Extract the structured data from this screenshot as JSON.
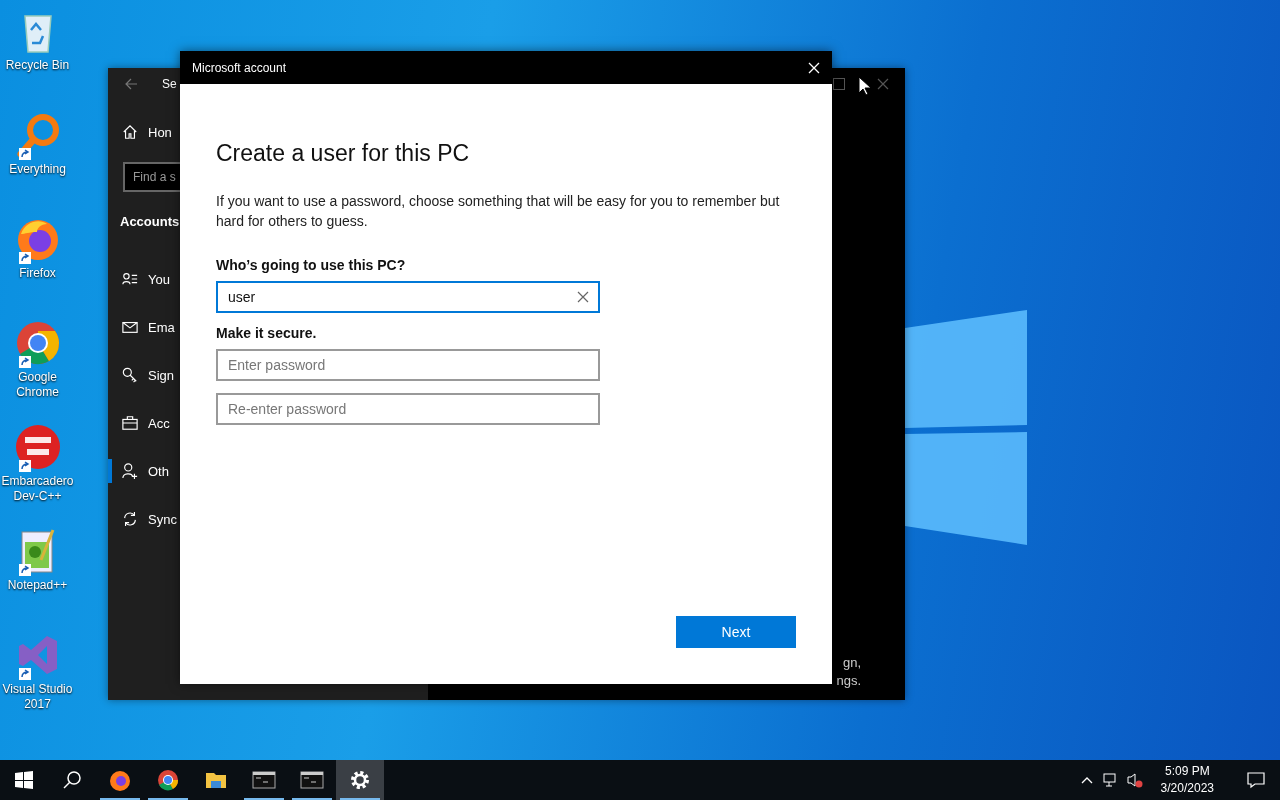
{
  "desktop_icons": [
    {
      "label": "Recycle Bin",
      "kind": "recycle",
      "shortcut": false
    },
    {
      "label": "Everything",
      "kind": "everything",
      "shortcut": true
    },
    {
      "label": "Firefox",
      "kind": "firefox",
      "shortcut": true
    },
    {
      "label": "Google Chrome",
      "kind": "chrome",
      "shortcut": true
    },
    {
      "label": "Embarcadero Dev-C++",
      "kind": "devcpp",
      "shortcut": true
    },
    {
      "label": "Notepad++",
      "kind": "notepadpp",
      "shortcut": true
    },
    {
      "label": "Visual Studio 2017",
      "kind": "vs",
      "shortcut": true
    }
  ],
  "settings_window": {
    "title": "Se",
    "home": {
      "label": "Hon"
    },
    "search": {
      "placeholder": "Find a s"
    },
    "section": "Accounts",
    "items": [
      {
        "label": "You",
        "kind": "info",
        "selected": false
      },
      {
        "label": "Ema",
        "kind": "mail",
        "selected": false
      },
      {
        "label": "Sign",
        "kind": "key",
        "selected": false
      },
      {
        "label": "Acc",
        "kind": "briefcase",
        "selected": false
      },
      {
        "label": "Oth",
        "kind": "person-add",
        "selected": true
      },
      {
        "label": "Sync",
        "kind": "sync",
        "selected": false
      }
    ],
    "footer_lines": [
      "gn,",
      "ngs."
    ]
  },
  "dialog": {
    "title": "Microsoft account",
    "heading": "Create a user for this PC",
    "description": "If you want to use a password, choose something that will be easy for you to remember but hard for others to guess.",
    "name_label": "Who’s going to use this PC?",
    "name_field": {
      "value": "user"
    },
    "secure_label": "Make it secure.",
    "password_fields": [
      {
        "placeholder": "Enter password"
      },
      {
        "placeholder": "Re-enter password"
      }
    ],
    "next_button": "Next"
  },
  "taskbar": {
    "apps": [
      {
        "kind": "firefox",
        "running": true,
        "selected": false
      },
      {
        "kind": "chrome",
        "running": true,
        "selected": false
      },
      {
        "kind": "folder",
        "running": false,
        "selected": false
      },
      {
        "kind": "terminal",
        "running": true,
        "selected": false
      },
      {
        "kind": "terminal",
        "running": true,
        "selected": false
      },
      {
        "kind": "gear",
        "running": true,
        "selected": true
      }
    ],
    "time": "5:09 PM",
    "date": "3/20/2023"
  }
}
